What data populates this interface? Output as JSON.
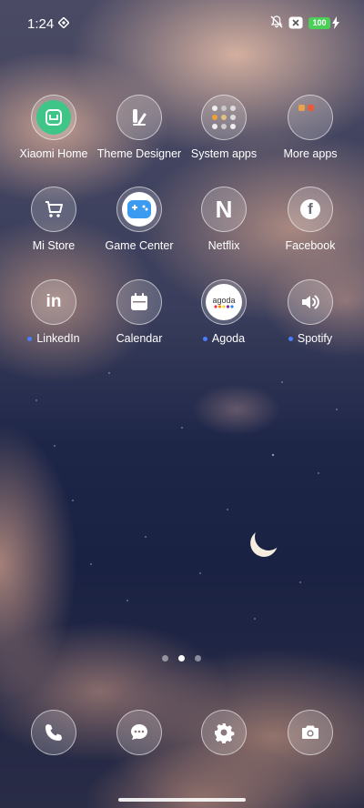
{
  "status_bar": {
    "time": "1:24",
    "battery": "100"
  },
  "apps_row1": [
    {
      "label": "Xiaomi Home",
      "icon": "xiaomi-home-icon"
    },
    {
      "label": "Theme Designer",
      "icon": "theme-designer-icon"
    },
    {
      "label": "System apps",
      "icon": "folder-icon"
    },
    {
      "label": "More apps",
      "icon": "folder-icon"
    }
  ],
  "apps_row2": [
    {
      "label": "Mi Store",
      "icon": "cart-icon"
    },
    {
      "label": "Game Center",
      "icon": "gamepad-icon"
    },
    {
      "label": "Netflix",
      "icon": "netflix-n-icon",
      "glyph": "N"
    },
    {
      "label": "Facebook",
      "icon": "facebook-icon",
      "glyph": "f"
    }
  ],
  "apps_row3": [
    {
      "label": "LinkedIn",
      "icon": "linkedin-icon",
      "glyph": "in",
      "new": true
    },
    {
      "label": "Calendar",
      "icon": "calendar-icon"
    },
    {
      "label": "Agoda",
      "icon": "agoda-icon",
      "glyph": "agoda",
      "new": true
    },
    {
      "label": "Spotify",
      "icon": "speaker-icon",
      "new": true
    }
  ],
  "dock": [
    {
      "icon": "phone-icon"
    },
    {
      "icon": "messages-icon"
    },
    {
      "icon": "settings-gear-icon"
    },
    {
      "icon": "camera-icon"
    }
  ],
  "colors": {
    "new_dot": "#4a7dff",
    "battery": "#4ad057"
  }
}
